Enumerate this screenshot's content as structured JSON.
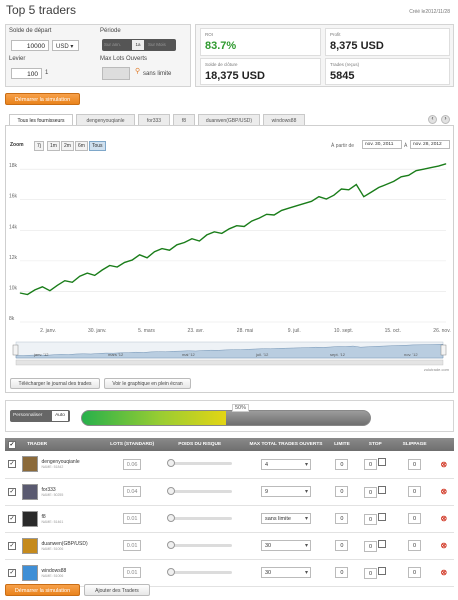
{
  "header": {
    "title": "Top 5 traders",
    "date": "Créé le2012/11/28"
  },
  "settings": {
    "capital_label": "Solde de départ",
    "capital_value": "10000",
    "currency": "USD",
    "leverage_label": "Levier",
    "leverage_value": "100",
    "leverage_suffix": "1",
    "period_label": "Période",
    "period_options": [
      "Sur ann.",
      "1a",
      "Sur Mois"
    ],
    "max_lots_label": "Max Lots Ouverts",
    "max_lots_value": "sans limite"
  },
  "stats": {
    "roi_label": "ROI",
    "roi_value": "83.7%",
    "profit_label": "Profit",
    "profit_value": "8,375 USD",
    "closing_label": "Solde de clôture",
    "closing_value": "18,375 USD",
    "trades_label": "Trades (reçus)",
    "trades_value": "5845"
  },
  "actions": {
    "start_simulation": "Démarrer la simulation",
    "add_traders": "Ajouter des Traders"
  },
  "tabs": [
    "Tous les fournisseurs",
    "dengenyouqianle",
    "for333",
    "f8",
    "duanwen(GBP/USD)",
    "windows88"
  ],
  "chart_controls": {
    "zoom_label": "Zoom",
    "zoom_options": [
      "7j",
      "1m",
      "2m",
      "6m",
      "Tous"
    ],
    "from_label": "À partir de",
    "from_date": "nov. 30, 2011",
    "to_label": "À",
    "to_date": "nov. 28, 2012",
    "credit": "zulutrade.com",
    "download_button": "Télécharger le journal des trades",
    "fullscreen_button": "Voir le graphique en plein écran"
  },
  "chart_data": {
    "type": "line",
    "x_ticks": [
      "2. janv.",
      "30. janv.",
      "5. mars",
      "23. avr.",
      "28. mai",
      "9. juil.",
      "10. sept.",
      "15. oct.",
      "26. nov."
    ],
    "y_ticks": [
      "8k",
      "10k",
      "12k",
      "14k",
      "16k",
      "18k"
    ],
    "ylim": [
      8000,
      18600
    ],
    "navigator_labels": [
      "janv. '12",
      "mars '12",
      "mai '12",
      "juil. '12",
      "sept. '12",
      "nov. '12"
    ],
    "series": [
      {
        "color": "#1a7d1a",
        "values": [
          9900,
          9800,
          10100,
          10300,
          10050,
          10400,
          10700,
          10600,
          11000,
          11200,
          11050,
          11400,
          11700,
          11600,
          11900,
          12050,
          12400,
          12200,
          12600,
          12800,
          12700,
          13050,
          13200,
          13450,
          13300,
          13700,
          13900,
          13800,
          14100,
          14300,
          14250,
          14600,
          14800,
          15050,
          15000,
          15300,
          15450,
          15600,
          15750,
          15900,
          16200,
          16050,
          16300,
          16700,
          16650,
          17000,
          16200,
          16500,
          16800,
          17000,
          17200,
          17500,
          17600,
          17900,
          18000,
          18100,
          18200,
          18350
        ]
      }
    ]
  },
  "allocation": {
    "toggle_personalize": "Personnaliser",
    "toggle_auto": "Auto",
    "percent": "50%",
    "fill": 0.5
  },
  "table": {
    "headers": [
      "TRADER",
      "LOTS (STANDARD)",
      "POIDS DU RISQUE",
      "MAX TOTAL TRADES OUVERTS",
      "LIMITE",
      "STOP",
      "SLIPPAGE"
    ],
    "rows": [
      {
        "name": "dengenyouqianle",
        "sub": "NAME: 51842",
        "lots": "0.06",
        "max_trades": "4",
        "limit": "0",
        "stop": "0",
        "slippage": "0",
        "avatar": "#8b6a3a"
      },
      {
        "name": "for333",
        "sub": "NAME: 50255",
        "lots": "0.04",
        "max_trades": "9",
        "limit": "0",
        "stop": "0",
        "slippage": "0",
        "avatar": "#5a5a70"
      },
      {
        "name": "f8",
        "sub": "NAME: 51461",
        "lots": "0.01",
        "max_trades": "sans limite",
        "limit": "0",
        "stop": "0",
        "slippage": "0",
        "avatar": "#2a2a2a"
      },
      {
        "name": "duanwen(GBP/USD)",
        "sub": "NAME: 51006",
        "lots": "0.01",
        "max_trades": "30",
        "limit": "0",
        "stop": "0",
        "slippage": "0",
        "avatar": "#c58a1c"
      },
      {
        "name": "windows88",
        "sub": "NAME: 51006",
        "lots": "0.01",
        "max_trades": "30",
        "limit": "0",
        "stop": "0",
        "slippage": "0",
        "avatar": "#3f8fd6"
      }
    ]
  }
}
